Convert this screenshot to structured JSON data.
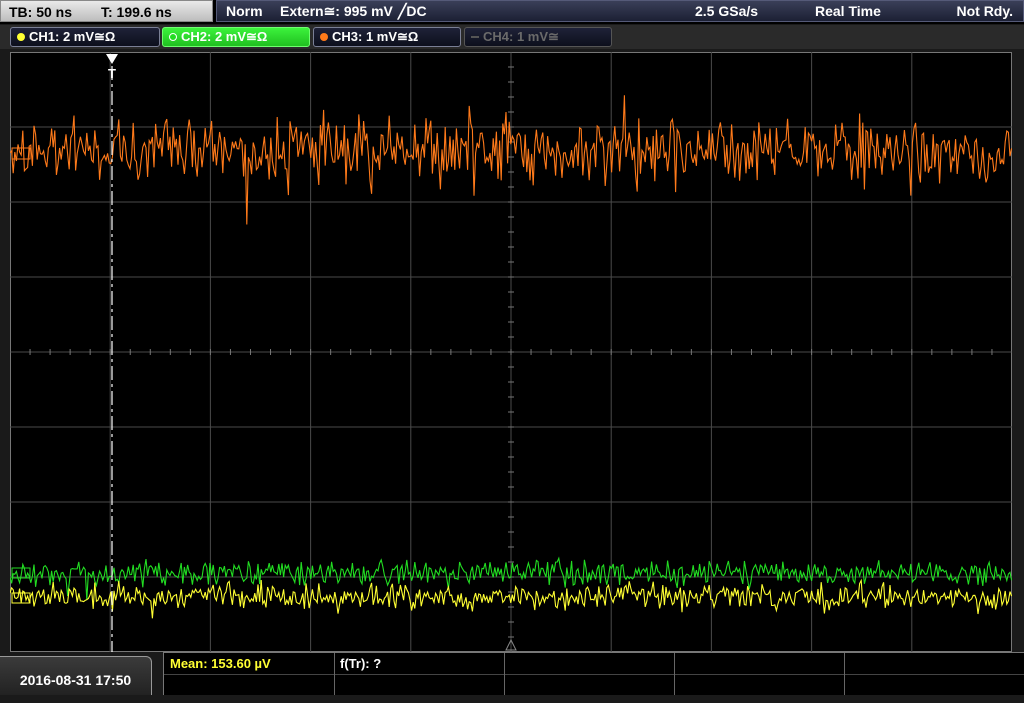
{
  "timebase": {
    "tb_label": "TB: 50 ns",
    "trigger_time_label": "T: 199.6 ns"
  },
  "status": {
    "mode": "Norm",
    "trigger_source": "Extern≅: 995 mV",
    "trigger_slope": "╱DC",
    "sample_rate": "2.5 GSa/s",
    "acq_mode": "Real Time",
    "state": "Not Rdy."
  },
  "channels": [
    {
      "label": "CH1: 2 mV≅Ω",
      "color": "#ffff33",
      "state": "on"
    },
    {
      "label": "CH2: 2 mV≅Ω",
      "color": "#22dd22",
      "state": "selected"
    },
    {
      "label": "CH3: 1 mV≅Ω",
      "color": "#ff7a1a",
      "state": "on"
    },
    {
      "label": "CH4: 1 mV≅",
      "color": "#666666",
      "state": "off"
    }
  ],
  "trigger_marker": "T",
  "footer": {
    "datetime": "2016-08-31 17:50",
    "measurement_1": "Mean: 153.60 µV",
    "measurement_2": "f(Tr): ?"
  },
  "colors": {
    "ch1": "#ffff33",
    "ch2": "#22dd22",
    "ch3": "#ff7a1a",
    "grid": "#4a4a4a",
    "cursor": "#ffffff"
  }
}
